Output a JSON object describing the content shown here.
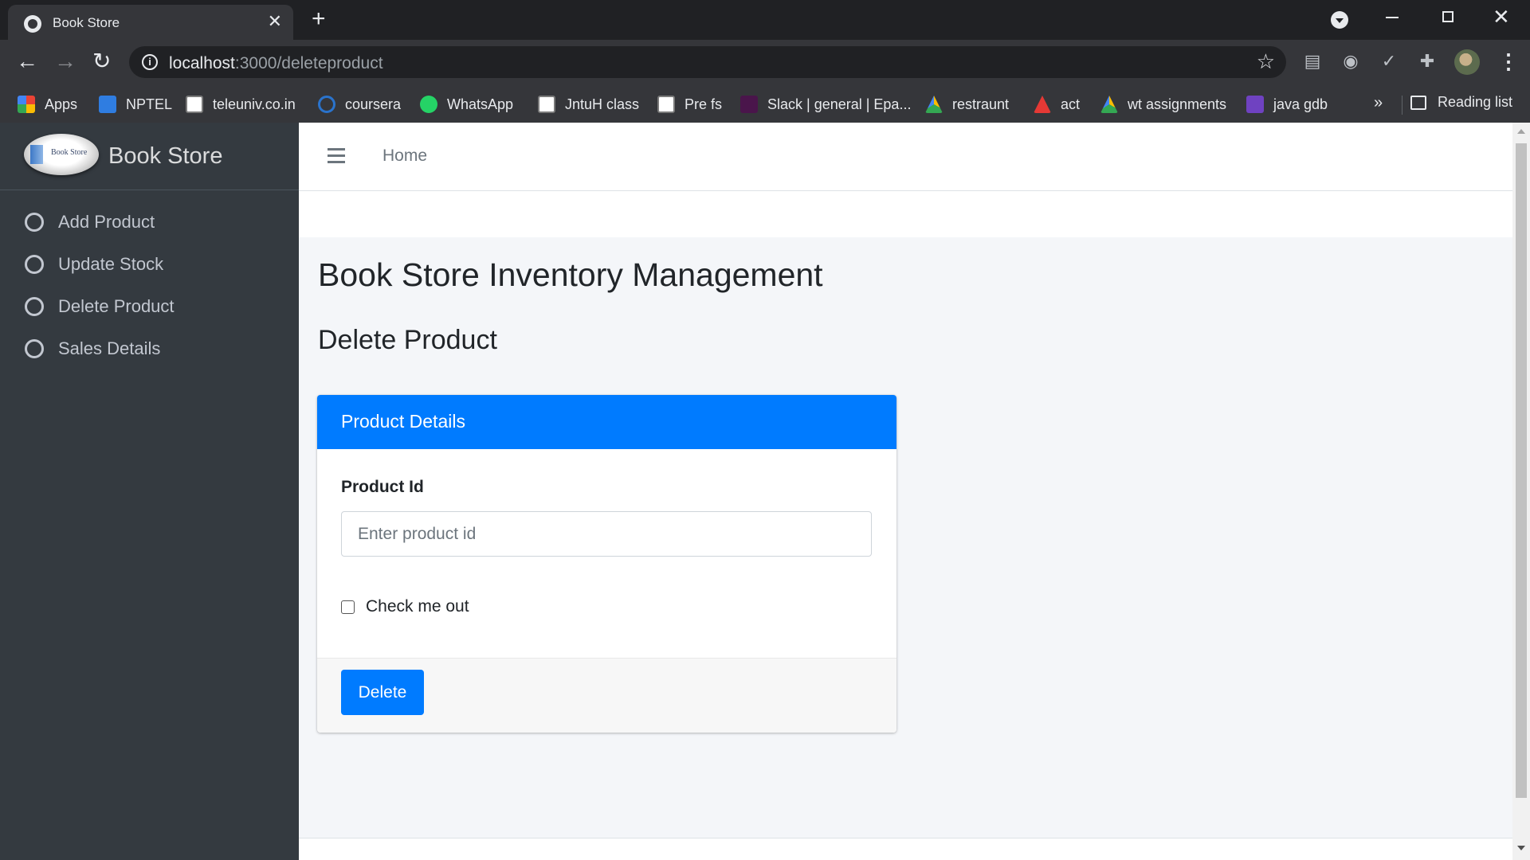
{
  "browser": {
    "tab_title": "Book Store",
    "url_host": "localhost",
    "url_path": ":3000/deleteproduct",
    "bookmarks": [
      {
        "label": "Apps",
        "color": "#e8453c"
      },
      {
        "label": "NPTEL",
        "color": "#2f7de1"
      },
      {
        "label": "teleuniv.co.in",
        "color": "#ffffff"
      },
      {
        "label": "coursera",
        "color": "#2a73cc"
      },
      {
        "label": "WhatsApp",
        "color": "#25d366"
      },
      {
        "label": "JntuH class",
        "color": "#ffffff"
      },
      {
        "label": "Pre fs",
        "color": "#ffffff"
      },
      {
        "label": "Slack | general | Epa...",
        "color": "#4a154b"
      },
      {
        "label": "restraunt",
        "color": "#fbbc04"
      },
      {
        "label": "act",
        "color": "#e53935"
      },
      {
        "label": "wt assignments",
        "color": "#34a853"
      },
      {
        "label": "java gdb",
        "color": "#6f42c1"
      }
    ],
    "more": "»",
    "reading_list": "Reading list"
  },
  "sidebar": {
    "brand": "Book Store",
    "logo_text": "Book Store",
    "items": [
      {
        "label": "Add Product"
      },
      {
        "label": "Update Stock"
      },
      {
        "label": "Delete Product"
      },
      {
        "label": "Sales Details"
      }
    ]
  },
  "topnav": {
    "home": "Home"
  },
  "main": {
    "title": "Book Store Inventory Management",
    "section": "Delete Product",
    "card": {
      "header": "Product Details",
      "field_label": "Product Id",
      "field_placeholder": "Enter product id",
      "field_value": "",
      "checkbox_label": "Check me out",
      "checkbox_checked": false,
      "button_label": "Delete"
    }
  },
  "colors": {
    "primary": "#007bff",
    "sidebar_bg": "#343a40",
    "content_bg": "#f4f6f9"
  }
}
